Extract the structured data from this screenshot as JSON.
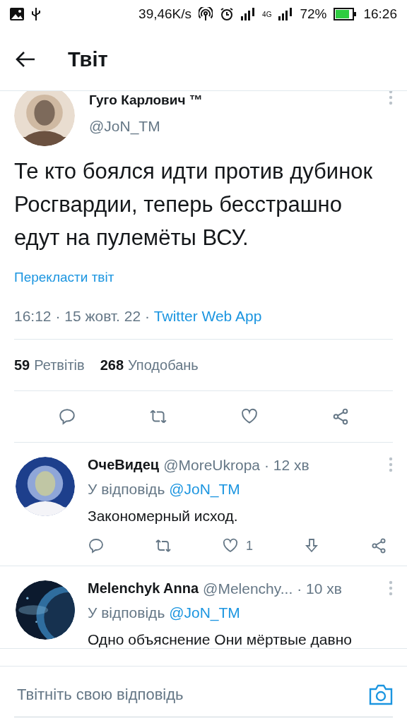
{
  "status_bar": {
    "speed": "39,46K/s",
    "network": "4G",
    "battery": "72%",
    "time": "16:26"
  },
  "header": {
    "title": "Твіт"
  },
  "tweet": {
    "name": "Гуго Карлович ™",
    "handle": "@JoN_TM",
    "text": "Те кто боялся идти против дубинок Росгвардии, теперь бесстрашно едут на пулемёты ВСУ.",
    "translate": "Перекласти твіт",
    "time": "16:12 · 15 жовт. 22 · ",
    "source": "Twitter Web App",
    "stats": [
      {
        "count": "59",
        "label": "Ретвітів"
      },
      {
        "count": "268",
        "label": "Уподобань"
      }
    ]
  },
  "replies": [
    {
      "name": "ОчеВидец",
      "handle": "@MoreUkropa",
      "time": "· 12 хв",
      "reply_to": "У відповідь",
      "mention": "@JoN_TM",
      "text": "Закономерный исход.",
      "likes": "1"
    },
    {
      "name": "Melenchyk Anna",
      "handle": "@Melenchy...",
      "time": "· 10 хв",
      "reply_to": "У відповідь",
      "mention": "@JoN_TM",
      "text": "Одно объяснение Они мёртвые давно"
    }
  ],
  "compose": {
    "placeholder": "Твітніть свою відповідь"
  }
}
